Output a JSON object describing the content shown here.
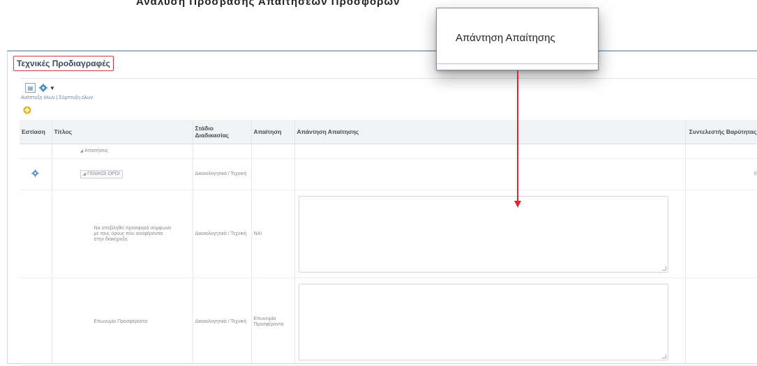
{
  "top_caption": "Ανάλυση Πρόσβασης Απαιτήσεων Προσφορών",
  "section_title": "Τεχνικές Προδιαγραφές",
  "toolbar": {
    "links": [
      "Ανάπτυξη όλων",
      "Σύμπτυξη όλων"
    ],
    "link_separator": " | "
  },
  "table": {
    "headers": {
      "focus": "Εστίαση",
      "title": "Τίτλος",
      "stage": "Στάδιο Διαδικασίας",
      "requirement": "Απαίτηση",
      "answer": "Απάντηση Απαίτησης",
      "weight": "Συντελεστής Βαρύτητας"
    },
    "rows": [
      {
        "title": "Απαιτήσεις",
        "stage": "",
        "requirement": ""
      },
      {
        "title": "ΓΕΝΙΚΟΙ ΟΡΟΙ",
        "stage": "Δικαιολογητικά / Τεχνική",
        "requirement": "",
        "weight": "0"
      },
      {
        "title": "Να υποβληθεί προσφορά σύμφωνα με τους όρους που αναφέρονται στην διακήρυξη",
        "stage": "Δικαιολογητικά / Τεχνική",
        "requirement": "ΝΑΙ"
      },
      {
        "title": "Επωνυμία Προσφέροντα",
        "stage": "Δικαιολογητικά / Τεχνική",
        "requirement": "Επωνυμία Προσφέροντα"
      }
    ]
  },
  "tooltip": {
    "text": "Απάντηση Απαίτησης"
  },
  "colors": {
    "highlight": "#d9343d",
    "arrow": "#e0282f",
    "header_bg": "#f2f3f5"
  },
  "icons": {
    "export": "export-icon",
    "settings": "gear-icon",
    "add": "add-icon",
    "focus": "focus-icon"
  }
}
